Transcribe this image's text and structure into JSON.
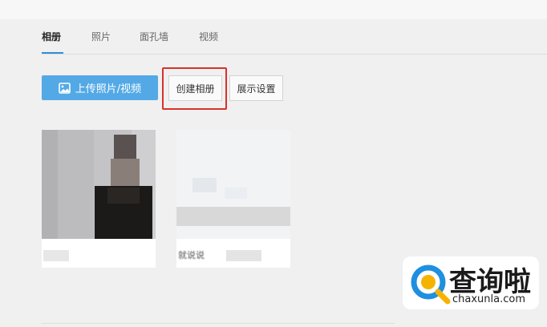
{
  "tabs": [
    {
      "label": "相册",
      "active": true
    },
    {
      "label": "照片",
      "active": false
    },
    {
      "label": "面孔墙",
      "active": false
    },
    {
      "label": "视频",
      "active": false
    }
  ],
  "toolbar": {
    "upload_label": "上传照片/视频",
    "create_album_label": "创建相册",
    "display_settings_label": "展示设置"
  },
  "albums": [
    {
      "title": ""
    },
    {
      "title": "就说说"
    }
  ],
  "watermark": {
    "brand": "查询啦",
    "domain": "chaxunla.com"
  },
  "colors": {
    "accent": "#2f8fd8",
    "upload_button": "#53a9e6",
    "highlight": "#d9312c"
  }
}
